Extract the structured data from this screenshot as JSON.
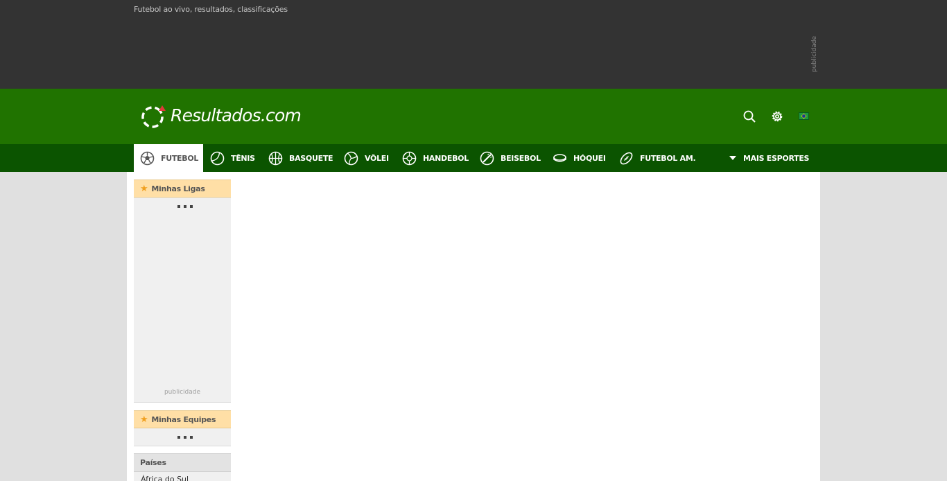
{
  "top": {
    "tagline": "Futebol ao vivo, resultados, classificações",
    "ad_label": "publicidade"
  },
  "header": {
    "logo_text": "Resultados.com",
    "icons": [
      "search-icon",
      "gear-icon",
      "brazil-flag-icon"
    ]
  },
  "sports": {
    "items": [
      {
        "label": "FUTEBOL",
        "icon": "soccer-ball-icon",
        "active": true
      },
      {
        "label": "TÊNIS",
        "icon": "tennis-ball-icon"
      },
      {
        "label": "BASQUETE",
        "icon": "basketball-icon"
      },
      {
        "label": "VÔLEI",
        "icon": "volleyball-icon"
      },
      {
        "label": "HANDEBOL",
        "icon": "handball-icon"
      },
      {
        "label": "BEISEBOL",
        "icon": "baseball-icon"
      },
      {
        "label": "HÓQUEI",
        "icon": "hockey-puck-icon"
      },
      {
        "label": "FUTEBOL AM.",
        "icon": "american-football-icon"
      }
    ],
    "more_label": "MAIS ESPORTES"
  },
  "sidebar": {
    "my_leagues_title": "Minhas Ligas",
    "ad_label": "publicidade",
    "my_teams_title": "Minhas Equipes",
    "countries_title": "Países",
    "countries": [
      "África do Sul"
    ]
  },
  "colors": {
    "topbar": "#333333",
    "header": "#207300",
    "sportnav": "#0b5400",
    "favorites_head": "#ffdfa6"
  }
}
